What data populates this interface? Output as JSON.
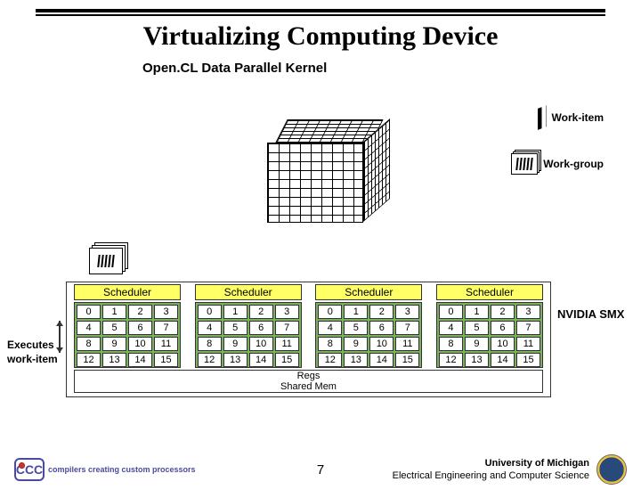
{
  "title": "Virtualizing Computing Device",
  "subtitle": "Open.CL Data Parallel Kernel",
  "legend": {
    "work_item": "Work-item",
    "work_group": "Work-group"
  },
  "left_label_line1": "Executes",
  "left_label_line2": "work-item",
  "scheduler_label": "Scheduler",
  "block_cores": [
    0,
    1,
    2,
    3,
    4,
    5,
    6,
    7,
    8,
    9,
    10,
    11,
    12,
    13,
    14,
    15
  ],
  "regs_label": "Regs",
  "shared_label": "Shared Mem",
  "right_label": "NVIDIA SMX",
  "footer": {
    "page": "7",
    "affil_line1": "University of Michigan",
    "affil_line2": "Electrical Engineering and Computer Science",
    "cccp_acronym": "CCC",
    "cccp_tag": "compilers creating custom processors"
  }
}
